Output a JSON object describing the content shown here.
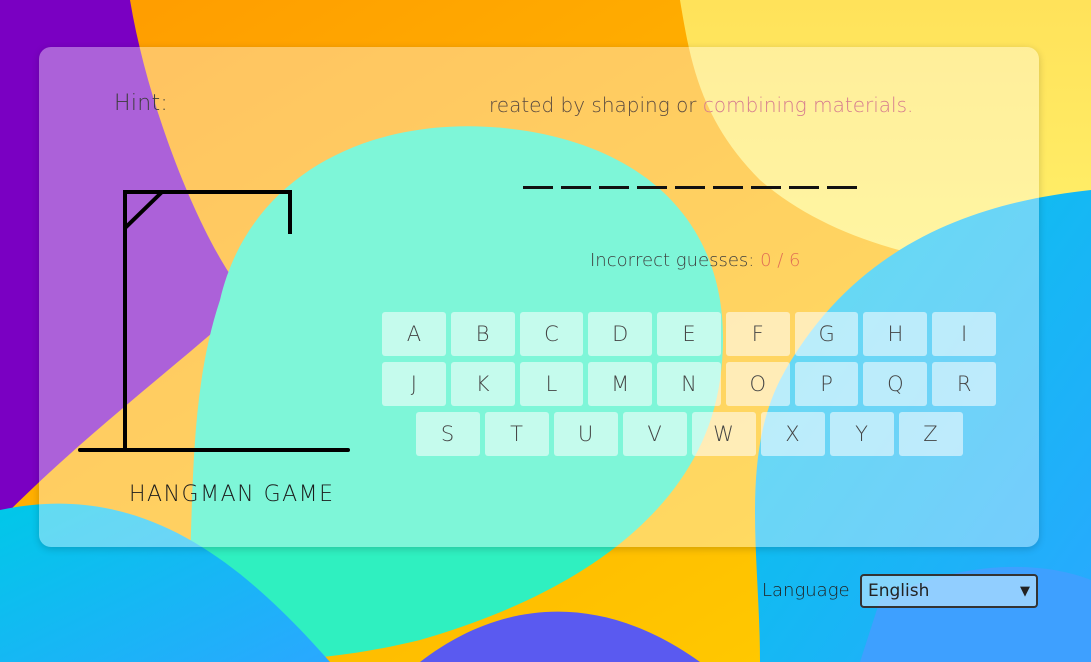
{
  "hint": {
    "label": "Hint:",
    "text_main": "reated by shaping or ",
    "text_faded": "combining materials."
  },
  "game": {
    "title": "HANGMAN GAME",
    "incorrect_label": "Incorrect guesses: ",
    "incorrect_count": "0 / 6",
    "word_slot_count": 9
  },
  "keyboard": {
    "rows": [
      [
        "A",
        "B",
        "C",
        "D",
        "E",
        "F",
        "G",
        "H",
        "I"
      ],
      [
        "J",
        "K",
        "L",
        "M",
        "N",
        "O",
        "P",
        "Q",
        "R"
      ],
      [
        "S",
        "T",
        "U",
        "V",
        "W",
        "X",
        "Y",
        "Z"
      ]
    ]
  },
  "language": {
    "label": "Language",
    "selected": "English"
  },
  "colors": {
    "accent_count": "#e17055",
    "hint_faded": "#d67b8f",
    "gallows": "#000000"
  }
}
